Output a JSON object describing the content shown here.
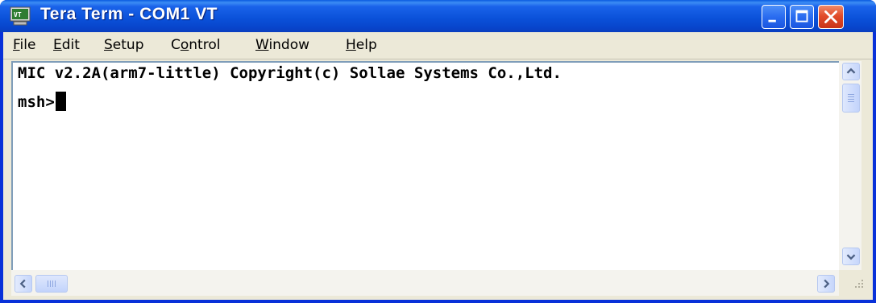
{
  "window": {
    "title": "Tera Term - COM1 VT",
    "app_icon": "terminal-icon",
    "controls": [
      "minimize-icon",
      "maximize-icon",
      "close-icon"
    ]
  },
  "menu": {
    "items": [
      {
        "label": "File",
        "mnemonic": "F"
      },
      {
        "label": "Edit",
        "mnemonic": "E"
      },
      {
        "label": "Setup",
        "mnemonic": "S"
      },
      {
        "label": "Control",
        "mnemonic": "o"
      },
      {
        "label": "Window",
        "mnemonic": "W"
      },
      {
        "label": "Help",
        "mnemonic": "H"
      }
    ]
  },
  "terminal": {
    "lines": [
      "MIC v2.2A(arm7-little) Copyright(c) Sollae Systems Co.,Ltd.",
      "msh>"
    ]
  },
  "colors": {
    "title_bar": "#0a50d8",
    "close_button": "#e24c2a",
    "terminal_background": "#ffffff",
    "terminal_text": "#000000"
  }
}
